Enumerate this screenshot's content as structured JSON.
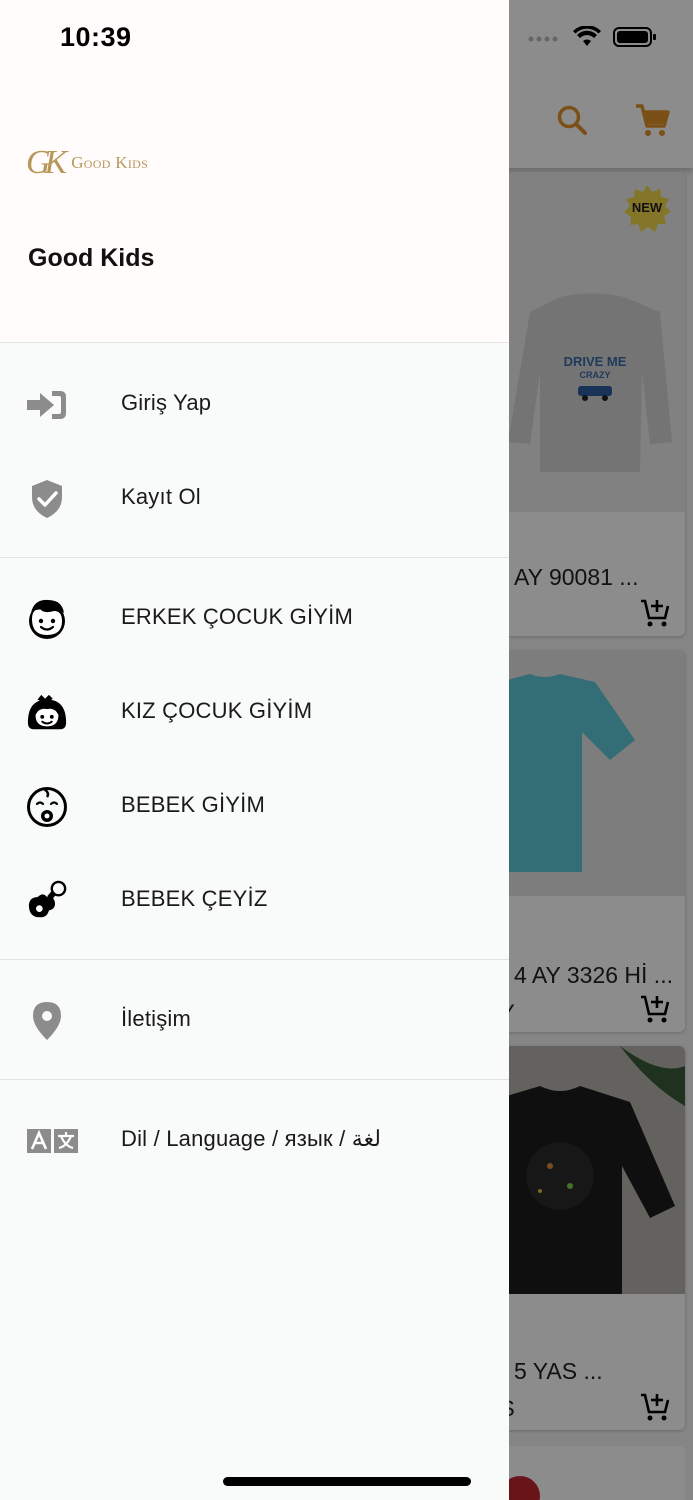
{
  "status_bar": {
    "time": "10:39"
  },
  "drawer": {
    "brand": {
      "mark": "GK",
      "text": "Good Kids"
    },
    "store_name": "Good Kids",
    "account_items": [
      {
        "label": "Giriş Yap",
        "icon": "sign-in-icon"
      },
      {
        "label": "Kayıt Ol",
        "icon": "shield-check-icon"
      }
    ],
    "category_items": [
      {
        "label": "ERKEK ÇOCUK GİYİM",
        "icon": "boy-face-icon"
      },
      {
        "label": "KIZ ÇOCUK GİYİM",
        "icon": "girl-face-icon"
      },
      {
        "label": "BEBEK GİYİM",
        "icon": "baby-face-icon"
      },
      {
        "label": "BEBEK ÇEYİZ",
        "icon": "pacifier-icon"
      }
    ],
    "contact_item": {
      "label": "İletişim",
      "icon": "location-pin-icon"
    },
    "language_item": {
      "label": "Dil / Language / язык / لغة",
      "icon": "translate-icon"
    }
  },
  "background": {
    "badge": "NEW",
    "shirt_print_line1": "DRIVE ME",
    "shirt_print_line2": "CRAZY",
    "products": [
      {
        "title": "AY 90081 ...",
        "sub": ""
      },
      {
        "title": "4 AY 3326 Hİ ...",
        "sub": "Y"
      },
      {
        "title": "5 YAS ...",
        "sub": "S"
      }
    ]
  },
  "colors": {
    "accent_gold": "#b8975b",
    "icon_gray": "#8c8c8c",
    "drawer_bg": "#f9fafa",
    "header_bg": "#fffcfb"
  }
}
